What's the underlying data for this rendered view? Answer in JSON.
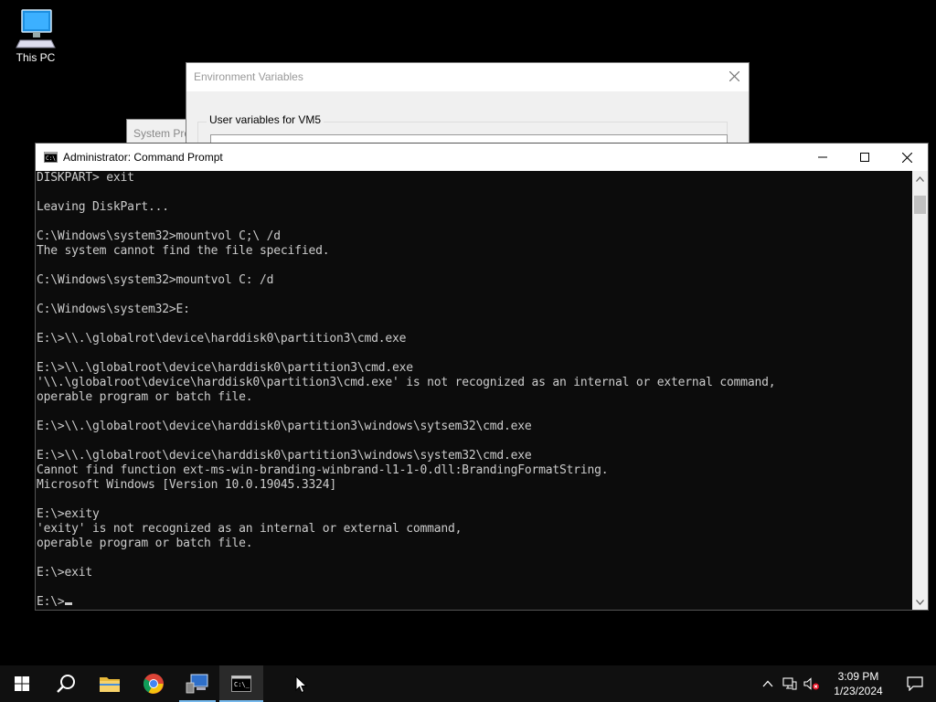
{
  "desktop": {
    "this_pc_label": "This PC"
  },
  "env_dialog": {
    "title": "Environment Variables",
    "group_label": "User variables for VM5"
  },
  "sys_props": {
    "title": "System Pro"
  },
  "cmd": {
    "title": "Administrator: Command Prompt",
    "lines": [
      "DISKPART> exit",
      "",
      "Leaving DiskPart...",
      "",
      "C:\\Windows\\system32>mountvol C;\\ /d",
      "The system cannot find the file specified.",
      "",
      "C:\\Windows\\system32>mountvol C: /d",
      "",
      "C:\\Windows\\system32>E:",
      "",
      "E:\\>\\\\.\\globalrot\\device\\harddisk0\\partition3\\cmd.exe",
      "",
      "E:\\>\\\\.\\globalroot\\device\\harddisk0\\partition3\\cmd.exe",
      "'\\\\.\\globalroot\\device\\harddisk0\\partition3\\cmd.exe' is not recognized as an internal or external command,",
      "operable program or batch file.",
      "",
      "E:\\>\\\\.\\globalroot\\device\\harddisk0\\partition3\\windows\\sytsem32\\cmd.exe",
      "",
      "E:\\>\\\\.\\globalroot\\device\\harddisk0\\partition3\\windows\\system32\\cmd.exe",
      "Cannot find function ext-ms-win-branding-winbrand-l1-1-0.dll:BrandingFormatString.",
      "Microsoft Windows [Version 10.0.19045.3324]",
      "",
      "E:\\>exity",
      "'exity' is not recognized as an internal or external command,",
      "operable program or batch file.",
      "",
      "E:\\>exit",
      ""
    ],
    "prompt": "E:\\>"
  },
  "taskbar": {
    "start_icon": "windows-logo-icon",
    "search_icon": "search-icon",
    "pinned": [
      "file-explorer-icon",
      "chrome-icon",
      "server-manager-icon",
      "command-prompt-icon"
    ],
    "tray_icons": [
      "chevron-up-icon",
      "network-icon",
      "volume-muted-icon"
    ],
    "time": "3:09 PM",
    "date": "1/23/2024"
  },
  "colors": {
    "console_bg": "#0c0c0c",
    "console_fg": "#cccccc",
    "taskbar_bg": "#101010",
    "active_underline": "#76b9ed"
  }
}
